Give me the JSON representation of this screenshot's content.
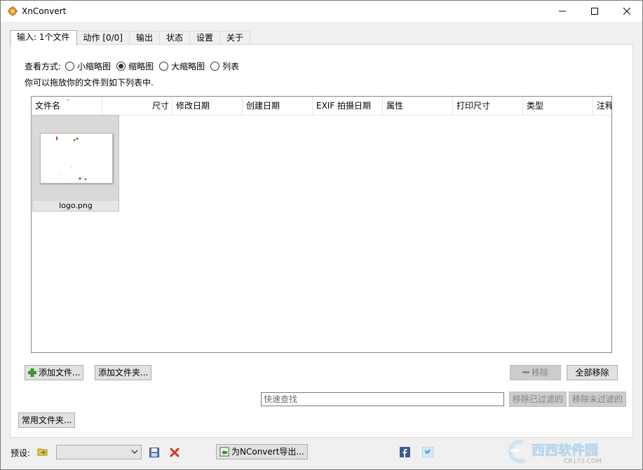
{
  "window": {
    "title": "XnConvert"
  },
  "tabs": [
    {
      "label": "输入: 1个文件",
      "active": true
    },
    {
      "label": "动作 [0/0]"
    },
    {
      "label": "输出"
    },
    {
      "label": "状态"
    },
    {
      "label": "设置"
    },
    {
      "label": "关于"
    }
  ],
  "view": {
    "label": "查看方式:",
    "options": [
      {
        "label": "小缩略图",
        "selected": false
      },
      {
        "label": "缩略图",
        "selected": true
      },
      {
        "label": "大缩略图",
        "selected": false
      },
      {
        "label": "列表",
        "selected": false
      }
    ]
  },
  "hint": "你可以拖放你的文件到如下列表中.",
  "columns": [
    "文件名",
    "尺寸",
    "修改日期",
    "创建日期",
    "EXIF 拍摄日期",
    "属性",
    "打印尺寸",
    "类型",
    "注释"
  ],
  "files": [
    {
      "name": "logo.png"
    }
  ],
  "buttons": {
    "add_file": "添加文件...",
    "add_folder": "添加文件夹...",
    "remove": "移除",
    "remove_all": "全部移除",
    "remove_filtered": "移除已过滤的",
    "remove_unfiltered": "移除未过滤的",
    "common_folders": "常用文件夹...",
    "export_nconvert": "为NConvert导出..."
  },
  "search": {
    "placeholder": "快速查找"
  },
  "preset": {
    "label": "预设:"
  },
  "watermark": {
    "text": "西西软件园",
    "url": "CR173.COM"
  },
  "colors": {
    "accent_red": "#d9342b",
    "facebook": "#3b5998",
    "twitter": "#55acee",
    "add_green": "#3a9d23"
  }
}
